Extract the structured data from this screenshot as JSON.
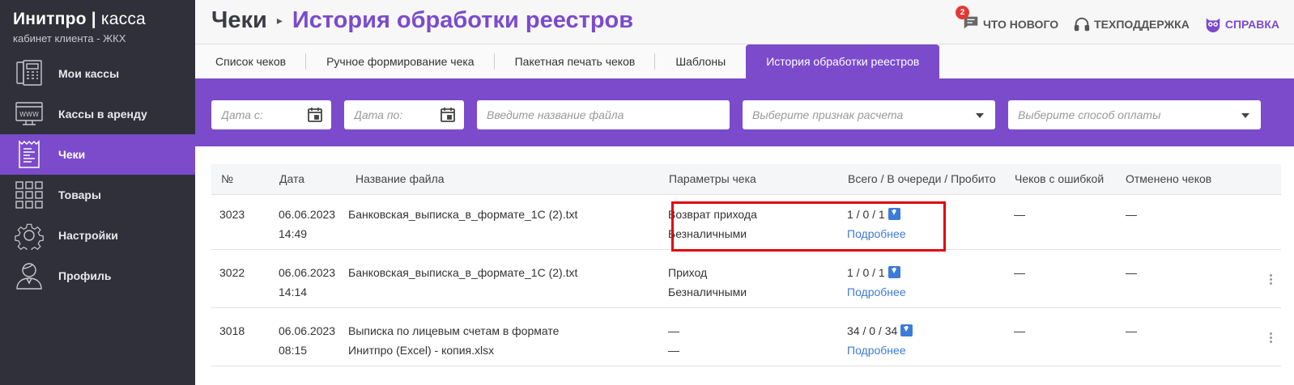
{
  "sidebar": {
    "logo_brand": "Инитпро",
    "logo_sep": "|",
    "logo_product": "касса",
    "logo_subtitle": "кабинет клиента - ЖКХ",
    "items": [
      {
        "label": "Мои кассы",
        "icon": "cash-register-icon",
        "active": false
      },
      {
        "label": "Кассы в аренду",
        "icon": "www-monitor-icon",
        "active": false
      },
      {
        "label": "Чеки",
        "icon": "receipt-icon",
        "active": true
      },
      {
        "label": "Товары",
        "icon": "grid-icon",
        "active": false
      },
      {
        "label": "Настройки",
        "icon": "gear-icon",
        "active": false
      },
      {
        "label": "Профиль",
        "icon": "user-icon",
        "active": false
      }
    ]
  },
  "header": {
    "crumb_root": "Чеки",
    "crumb_current": "История обработки реестров",
    "whats_new": "ЧТО НОВОГО",
    "whats_new_badge": "2",
    "support": "ТЕХПОДДЕРЖКА",
    "help": "СПРАВКА"
  },
  "tabs": [
    {
      "label": "Список чеков",
      "active": false
    },
    {
      "label": "Ручное формирование чека",
      "active": false
    },
    {
      "label": "Пакетная печать чеков",
      "active": false
    },
    {
      "label": "Шаблоны",
      "active": false
    },
    {
      "label": "История обработки реестров",
      "active": true
    }
  ],
  "filters": {
    "date_from_placeholder": "Дата с:",
    "date_to_placeholder": "Дата по:",
    "file_name_placeholder": "Введите название файла",
    "calc_sign_placeholder": "Выберите признак расчета",
    "payment_method_placeholder": "Выберите способ оплаты"
  },
  "table": {
    "columns": [
      "№",
      "Дата",
      "Название файла",
      "Параметры чека",
      "Всего / В очереди / Пробито",
      "Чеков с ошибкой",
      "Отменено чеков"
    ],
    "rows": [
      {
        "num": "3023",
        "date": "06.06.2023",
        "time": "14:49",
        "file_line1": "Банковская_выписка_в_формате_1С (2).txt",
        "file_line2": "",
        "param1": "Возврат прихода",
        "param2": "Безналичными",
        "counts": "1 / 0 / 1",
        "details": "Подробнее",
        "errors": "—",
        "canceled": "—"
      },
      {
        "num": "3022",
        "date": "06.06.2023",
        "time": "14:14",
        "file_line1": "Банковская_выписка_в_формате_1С (2).txt",
        "file_line2": "",
        "param1": "Приход",
        "param2": "Безналичными",
        "counts": "1 / 0 / 1",
        "details": "Подробнее",
        "errors": "—",
        "canceled": "—"
      },
      {
        "num": "3018",
        "date": "06.06.2023",
        "time": "08:15",
        "file_line1": "Выписка по лицевым счетам в формате",
        "file_line2": "Инитпро (Excel) - копия.xlsx",
        "param1": "—",
        "param2": "—",
        "counts": "34 / 0 / 34",
        "details": "Подробнее",
        "errors": "—",
        "canceled": "—"
      }
    ]
  },
  "colors": {
    "accent": "#7b4bcc",
    "sidebar_bg": "#2f3039",
    "link": "#3d7bd8",
    "highlight": "#e0060b"
  }
}
